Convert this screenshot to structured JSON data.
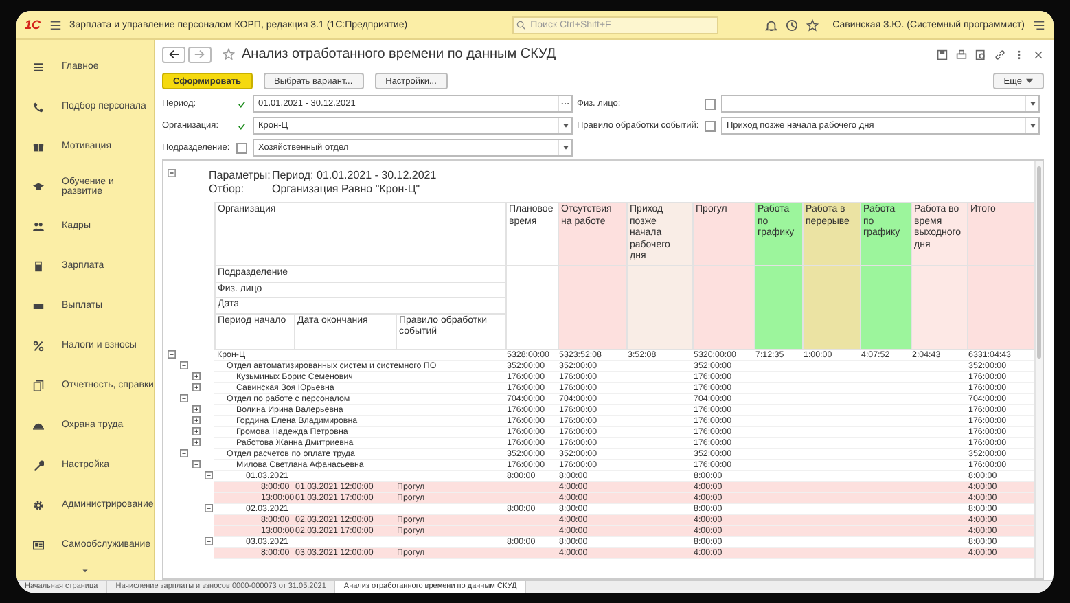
{
  "topbar": {
    "logo": "1С",
    "title": "Зарплата и управление персоналом КОРП, редакция 3.1 (1С:Предприятие)",
    "search": {
      "placeholder": "Поиск Ctrl+Shift+F"
    },
    "user": "Савинская З.Ю. (Системный программист)"
  },
  "sidebar": {
    "items": [
      {
        "label": "Главное"
      },
      {
        "label": "Подбор персонала"
      },
      {
        "label": "Мотивация"
      },
      {
        "label": "Обучение и развитие"
      },
      {
        "label": "Кадры"
      },
      {
        "label": "Зарплата"
      },
      {
        "label": "Выплаты"
      },
      {
        "label": "Налоги и взносы"
      },
      {
        "label": "Отчетность, справки"
      },
      {
        "label": "Охрана труда"
      },
      {
        "label": "Настройка"
      },
      {
        "label": "Администрирование"
      },
      {
        "label": "Самообслуживание"
      }
    ]
  },
  "form": {
    "title": "Анализ отработанного времени по данным СКУД",
    "buttons": [
      {
        "label": "Сформировать",
        "kind": "primary"
      },
      {
        "label": "Выбрать вариант...",
        "kind": "normal"
      },
      {
        "label": "Настройки...",
        "kind": "normal"
      }
    ],
    "more_button": "Еще",
    "filters": {
      "left": [
        {
          "label": "Период:",
          "checked": true,
          "value": "01.01.2021 - 30.12.2021",
          "kind": "period"
        },
        {
          "label": "Организация:",
          "checked": true,
          "value": "Крон-Ц",
          "kind": "select"
        },
        {
          "label": "Подразделение:",
          "checked": false,
          "value": "Хозяйственный отдел",
          "kind": "select"
        }
      ],
      "right": [
        {
          "label": "Физ. лицо:",
          "checked": false,
          "kind": "select"
        },
        {
          "label": "Правило обработки событий:",
          "checked": false,
          "value": "Приход позже начала рабочего дня",
          "kind": "select"
        }
      ]
    }
  },
  "report": {
    "params": [
      {
        "label": "Параметры:",
        "value": "Период: 01.01.2021 - 30.12.2021"
      },
      {
        "label": "Отбор:",
        "value": "Организация Равно \"Крон-Ц\""
      }
    ],
    "header": {
      "organization": "Организация",
      "subdivision": "Подразделение",
      "person": "Физ. лицо",
      "date": "Дата",
      "start": "Период начало",
      "end": "Дата окончания",
      "rule": "Правило обработки событий"
    },
    "columns": [
      {
        "label": "Плановое время",
        "color": "#ffffff"
      },
      {
        "label": "Отсутствия на работе",
        "color": "#fde0de"
      },
      {
        "label": "Приход позже начала рабочего дня",
        "color": "#f9ede6"
      },
      {
        "label": "Прогул",
        "color": "#fde0de"
      },
      {
        "label": "Работа по графику",
        "color": "#9cf59c"
      },
      {
        "label": "Работа в перерыве",
        "color": "#ebe3a3"
      },
      {
        "label": "Работа по графику",
        "color": "#9cf59c"
      },
      {
        "label": "Работа во время выходного дня",
        "color": "#fde8e5"
      },
      {
        "label": "Итого",
        "color": "#fde0de"
      }
    ],
    "rows": [
      {
        "name": "Крон-Ц",
        "expanded": true,
        "values": {
          "plan": "5328:00:00",
          "absence": "5323:52:08",
          "late": "3:52:08",
          "truancy": "5320:00:00",
          "scheduled": "7:12:35",
          "break": "1:00:00",
          "scheduled_2": "4:07:52",
          "weekend": "2:04:43",
          "total": "6331:04:43"
        },
        "children": [
          {
            "name": "Отдел автоматизированных систем и системного ПО",
            "expanded": true,
            "values": {
              "plan": "352:00:00",
              "absence": "352:00:00",
              "truancy": "352:00:00",
              "total": "352:00:00"
            },
            "children": [
              {
                "name": "Кузьминых Борис Семенович",
                "expanded": false,
                "values": {
                  "plan": "176:00:00",
                  "absence": "176:00:00",
                  "truancy": "176:00:00",
                  "total": "176:00:00"
                }
              },
              {
                "name": "Савинская Зоя Юрьевна",
                "expanded": false,
                "values": {
                  "plan": "176:00:00",
                  "absence": "176:00:00",
                  "truancy": "176:00:00",
                  "total": "176:00:00"
                }
              }
            ]
          },
          {
            "name": "Отдел по работе с персоналом",
            "expanded": true,
            "values": {
              "plan": "704:00:00",
              "absence": "704:00:00",
              "truancy": "704:00:00",
              "total": "704:00:00"
            },
            "children": [
              {
                "name": "Волина Ирина Валерьевна",
                "expanded": false,
                "values": {
                  "plan": "176:00:00",
                  "absence": "176:00:00",
                  "truancy": "176:00:00",
                  "total": "176:00:00"
                }
              },
              {
                "name": "Гордина Елена Владимировна",
                "expanded": false,
                "values": {
                  "plan": "176:00:00",
                  "absence": "176:00:00",
                  "truancy": "176:00:00",
                  "total": "176:00:00"
                }
              },
              {
                "name": "Громова Надежда Петровна",
                "expanded": false,
                "values": {
                  "plan": "176:00:00",
                  "absence": "176:00:00",
                  "truancy": "176:00:00",
                  "total": "176:00:00"
                }
              },
              {
                "name": "Работова Жанна Дмитриевна",
                "expanded": false,
                "values": {
                  "plan": "176:00:00",
                  "absence": "176:00:00",
                  "truancy": "176:00:00",
                  "total": "176:00:00"
                }
              }
            ]
          },
          {
            "name": "Отдел расчетов по оплате труда",
            "expanded": true,
            "values": {
              "plan": "352:00:00",
              "absence": "352:00:00",
              "truancy": "352:00:00",
              "total": "352:00:00"
            },
            "children": [
              {
                "name": "Милова Светлана Афанасьевна",
                "expanded": true,
                "values": {
                  "plan": "176:00:00",
                  "absence": "176:00:00",
                  "truancy": "176:00:00",
                  "total": "176:00:00"
                },
                "children": [
                  {
                    "name": "01.03.2021",
                    "expanded": true,
                    "values": {
                      "plan": "8:00:00",
                      "absence": "8:00:00",
                      "truancy": "8:00:00",
                      "total": "8:00:00"
                    },
                    "children": [
                      {
                        "start": "8:00:00",
                        "end": "01.03.2021 12:00:00",
                        "rule": "Прогул",
                        "values": {
                          "absence": "4:00:00",
                          "truancy": "4:00:00",
                          "total": "4:00:00"
                        }
                      },
                      {
                        "start": "13:00:00",
                        "end": "01.03.2021 17:00:00",
                        "rule": "Прогул",
                        "values": {
                          "absence": "4:00:00",
                          "truancy": "4:00:00",
                          "total": "4:00:00"
                        }
                      }
                    ]
                  },
                  {
                    "name": "02.03.2021",
                    "expanded": true,
                    "values": {
                      "plan": "8:00:00",
                      "absence": "8:00:00",
                      "truancy": "8:00:00",
                      "total": "8:00:00"
                    },
                    "children": [
                      {
                        "start": "8:00:00",
                        "end": "02.03.2021 12:00:00",
                        "rule": "Прогул",
                        "values": {
                          "absence": "4:00:00",
                          "truancy": "4:00:00",
                          "total": "4:00:00"
                        }
                      },
                      {
                        "start": "13:00:00",
                        "end": "02.03.2021 17:00:00",
                        "rule": "Прогул",
                        "values": {
                          "absence": "4:00:00",
                          "truancy": "4:00:00",
                          "total": "4:00:00"
                        }
                      }
                    ]
                  },
                  {
                    "name": "03.03.2021",
                    "expanded": true,
                    "values": {
                      "plan": "8:00:00",
                      "absence": "8:00:00",
                      "truancy": "8:00:00",
                      "total": "8:00:00"
                    },
                    "children": [
                      {
                        "start": "8:00:00",
                        "end": "03.03.2021 12:00:00",
                        "rule": "Прогул",
                        "values": {
                          "absence": "4:00:00",
                          "truancy": "4:00:00",
                          "total": "4:00:00"
                        }
                      }
                    ]
                  }
                ]
              }
            ]
          }
        ]
      }
    ]
  },
  "taskbar": {
    "tabs": [
      {
        "label": "Начальная страница",
        "selected": false
      },
      {
        "label": "Начисление зарплаты и взносов 0000-000073 от 31.05.2021",
        "selected": false
      },
      {
        "label": "Анализ отработанного времени по данным СКУД",
        "selected": true
      }
    ]
  }
}
